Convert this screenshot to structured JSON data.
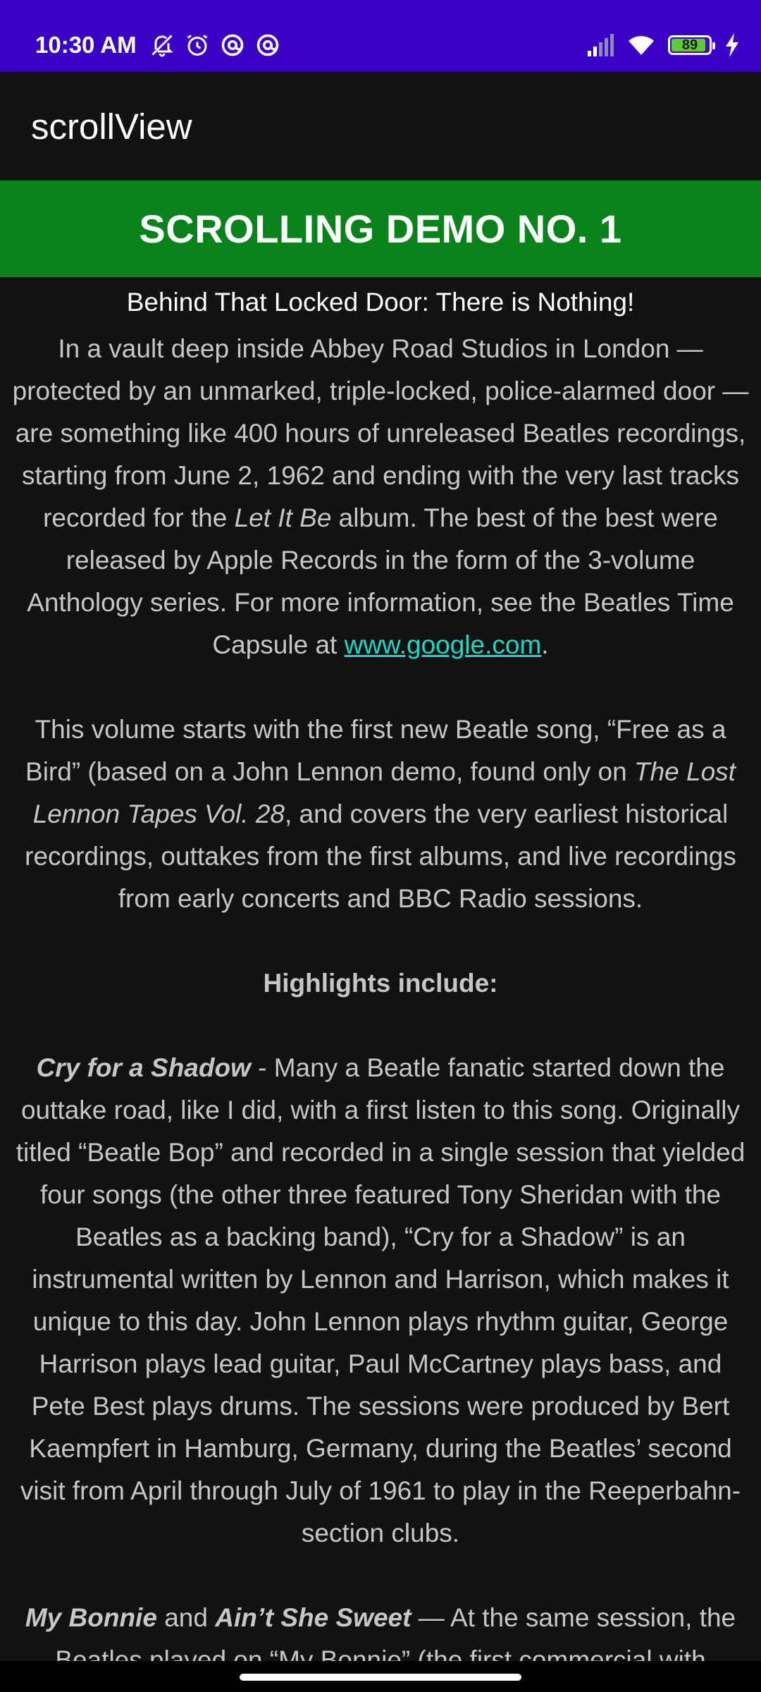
{
  "status_bar": {
    "time": "10:30 AM",
    "battery_level": "89",
    "battery_fraction": 0.89,
    "background_color": "#3a00c4",
    "left_icons": [
      "muted-bell-icon",
      "alarm-clock-icon",
      "at-sign-icon",
      "at-sign-icon"
    ],
    "right_icons": [
      "cell-signal-icon",
      "wifi-icon",
      "battery-icon",
      "charging-bolt-icon"
    ]
  },
  "app_bar": {
    "title": "scrollView"
  },
  "banner": {
    "text": "SCROLLING DEMO NO. 1",
    "background_color": "#0a821c"
  },
  "content": {
    "subtitle": "Behind That Locked Door: There is Nothing!",
    "p1": {
      "a": "In a vault deep inside Abbey Road Studios in London — protected by an unmarked, triple-locked, police-alarmed door — are something like 400 hours of unreleased Beatles recordings, starting from June 2, 1962 and ending with the very last tracks recorded for the ",
      "album": "Let It Be",
      "b": " album. The best of the best were released by Apple Records in the form of the 3-volume Anthology series. For more information, see the Beatles Time Capsule at ",
      "link": "www.google.com",
      "c": "."
    },
    "p2": {
      "a": "This volume starts with the first new Beatle song, “Free as a Bird” (based on a John Lennon demo, found only on ",
      "title": "The Lost Lennon Tapes Vol. 28",
      "b": ", and covers the very earliest historical recordings, outtakes from the first albums, and live recordings from early concerts and BBC Radio sessions."
    },
    "highlights_heading": "Highlights include:",
    "p3": {
      "song": "Cry for a Shadow",
      "text": " - Many a Beatle fanatic started down the outtake road, like I did, with a first listen to this song. Originally titled “Beatle Bop” and recorded in a single session that yielded four songs (the other three featured Tony Sheridan with the Beatles as a backing band), “Cry for a Shadow” is an instrumental written by Lennon and Harrison, which makes it unique to this day. John Lennon plays rhythm guitar, George Harrison plays lead guitar, Paul McCartney plays bass, and Pete Best plays drums. The sessions were produced by Bert Kaempfert in Hamburg, Germany, during the Beatles’ second visit from April through July of 1961 to play in the Reeperbahn-section clubs."
    },
    "p4": {
      "song1": "My Bonnie",
      "and": " and ",
      "song2": "Ain’t She Sweet",
      "text": " — At the same session, the Beatles played on “My Bonnie” (the first commercial with"
    },
    "link_color": "#1fd6c6"
  }
}
